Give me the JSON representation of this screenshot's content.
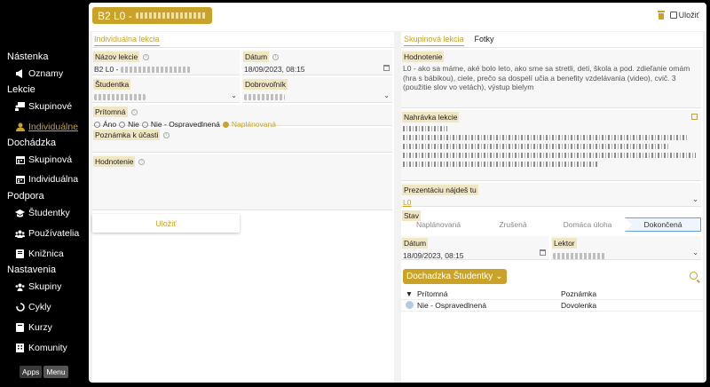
{
  "sidebar": {
    "sections": {
      "nastenka": "Nástenka",
      "lekcie": "Lekcie",
      "dochadzka": "Dochádzka",
      "podpora": "Podpora",
      "nastavenia": "Nastavenia"
    },
    "items": {
      "oznamy": "Oznamy",
      "skupinove": "Skupinové",
      "individualne": "Individuálne",
      "dochadzka_skupinova": "Skupinová",
      "dochadzka_individualna": "Individuálna",
      "studentky": "Študentky",
      "pouzivatelia": "Používatelia",
      "kniznica": "Knižnica",
      "skupiny": "Skupiny",
      "cykly": "Cykly",
      "kurzy": "Kurzy",
      "komunity": "Komunity"
    },
    "buttons": {
      "apps": "Apps",
      "menu": "Menu"
    }
  },
  "header": {
    "title": "B2 L0 -",
    "save_label": "Uložiť"
  },
  "left": {
    "tab": "Individuálna lekcia",
    "nazov": {
      "label": "Názov lekcie",
      "value": "B2 L0 -"
    },
    "datum": {
      "label": "Dátum",
      "value": "18/09/2023, 08:15"
    },
    "studentka": {
      "label": "Študentka"
    },
    "dobrovolnik": {
      "label": "Dobrovoľník"
    },
    "pritomna": {
      "label": "Prítomná",
      "options": [
        "Áno",
        "Nie",
        "Nie - Ospravedlnená",
        "Naplánovaná"
      ],
      "selected": "Naplánovaná"
    },
    "poznamka": {
      "label": "Poznámka k účasti"
    },
    "hodnotenie": {
      "label": "Hodnotenie"
    },
    "save_button": "Uložiť"
  },
  "right": {
    "tabs": [
      "Skupinová lekcia",
      "Fotky"
    ],
    "hodnotenie": {
      "label": "Hodnotenie",
      "text": "L0 - ako sa máme, aké bolo leto, ako sme sa stretli, deti, škola a pod. zdieľanie omám (hra s bábikou), ciele, prečo sa dospelí učia a benefity vzdelávania (video), cvič. 3 (použitie slov vo vetách), výstup bielym"
    },
    "nahravka": {
      "label": "Nahrávka lekcie"
    },
    "prezentacia": {
      "label": "Prezentáciu nájdeš tu",
      "value": "L0"
    },
    "stav": {
      "label": "Stav",
      "steps": [
        "Naplánovaná",
        "Zrušená",
        "Domáca úloha",
        "Dokončená"
      ],
      "active": "Dokončená"
    },
    "datum": {
      "label": "Dátum",
      "value": "18/09/2023, 08:15"
    },
    "lektor": {
      "label": "Lektor"
    },
    "dochadzka": {
      "button": "Dochadzka Študentky",
      "sort_indicator": "▼",
      "columns": [
        "Prítomná",
        "Poznámka"
      ],
      "rows": [
        {
          "pritomna": "Nie - Ospravedlnená",
          "poznamka": "Dovolenka"
        }
      ]
    }
  },
  "colors": {
    "accent": "#c9a227",
    "sidebar_bg": "#000000",
    "active_step": "#6aa0d8"
  }
}
